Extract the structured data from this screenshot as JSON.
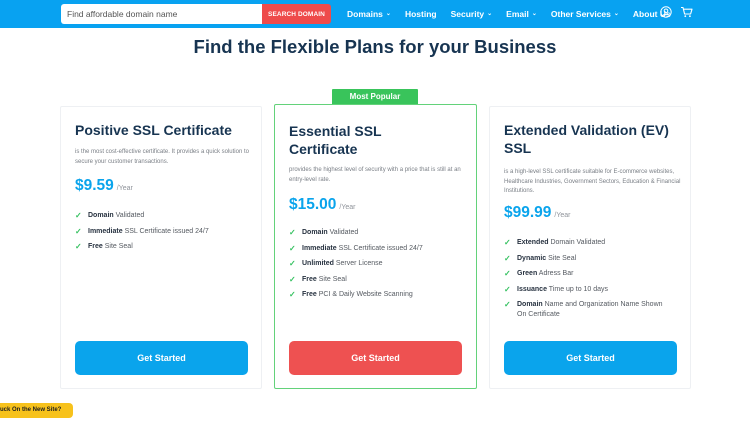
{
  "header": {
    "search_placeholder": "Find affordable domain name",
    "search_button": "SEARCH DOMAIN",
    "nav": [
      {
        "label": "Domains",
        "dropdown": true
      },
      {
        "label": "Hosting",
        "dropdown": false
      },
      {
        "label": "Security",
        "dropdown": true
      },
      {
        "label": "Email",
        "dropdown": true
      },
      {
        "label": "Other Services",
        "dropdown": true
      },
      {
        "label": "About Us",
        "dropdown": false
      }
    ],
    "icons": [
      "user-icon",
      "cart-icon"
    ]
  },
  "heading": "Find the Flexible Plans for your Business",
  "badge": "Most Popular",
  "plans": [
    {
      "title": "Positive SSL Certificate",
      "description": "is the most cost-effective certificate. It provides a quick solution to secure your customer transactions.",
      "price": "$9.59",
      "period": "/Year",
      "features": [
        {
          "bold": "Domain",
          "text": " Validated"
        },
        {
          "bold": "Immediate",
          "text": " SSL Certificate issued 24/7"
        },
        {
          "bold": "Free",
          "text": " Site Seal"
        }
      ],
      "cta": "Get Started"
    },
    {
      "title": "Essential SSL Certificate",
      "description": "provides the highest level of security with a price that is still at an entry-level rate.",
      "price": "$15.00",
      "period": "/Year",
      "features": [
        {
          "bold": "Domain",
          "text": " Validated"
        },
        {
          "bold": "Immediate",
          "text": " SSL Certificate issued 24/7"
        },
        {
          "bold": "Unlimited",
          "text": " Server License"
        },
        {
          "bold": "Free",
          "text": " Site Seal"
        },
        {
          "bold": "Free",
          "text": " PCI & Daily Website Scanning"
        }
      ],
      "cta": "Get Started"
    },
    {
      "title": "Extended Validation (EV) SSL",
      "description": "is a high-level SSL certificate suitable for E-commerce websites, Healthcare Industries, Government Sectors, Education & Financial Institutions.",
      "price": "$99.99",
      "period": "/Year",
      "features": [
        {
          "bold": "Extended",
          "text": " Domain Validated"
        },
        {
          "bold": "Dynamic",
          "text": " Site Seal"
        },
        {
          "bold": "Green",
          "text": " Adress Bar"
        },
        {
          "bold": "Issuance",
          "text": " Time up to 10 days"
        },
        {
          "bold": "Domain",
          "text": " Name and Organization Name Shown On Certificate"
        }
      ],
      "cta": "Get Started"
    }
  ],
  "feedback_tab": "Stuck On the New Site?",
  "colors": {
    "topbar": "#08a2f1",
    "search_button": "#ee4b4b",
    "heading": "#173451",
    "price": "#0aa4ec",
    "featured_border": "#63d27a",
    "badge": "#39c45b",
    "check": "#35c160",
    "cta_blue": "#0aa4ec",
    "cta_red": "#ee5151",
    "feedback_tab": "#f7c21c"
  }
}
